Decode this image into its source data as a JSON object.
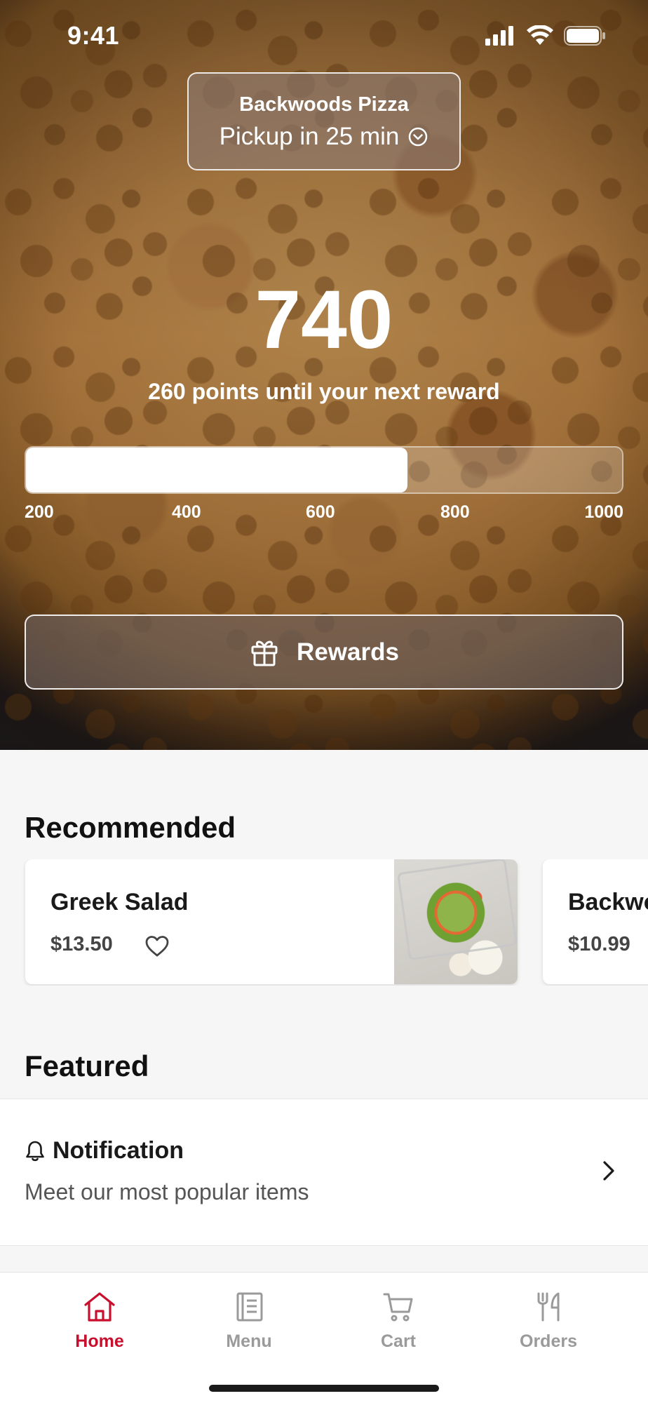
{
  "status_bar": {
    "time": "9:41"
  },
  "pickup": {
    "store_name": "Backwoods Pizza",
    "pickup_time": "Pickup in 25 min"
  },
  "points": {
    "value": "740",
    "subtitle": "260 points until your next reward",
    "progress_fraction": 0.64,
    "scale_labels": [
      "200",
      "400",
      "600",
      "800",
      "1000"
    ]
  },
  "rewards_button": {
    "label": "Rewards"
  },
  "recommended": {
    "title": "Recommended",
    "items": [
      {
        "name": "Greek Salad",
        "price": "$13.50"
      },
      {
        "name": "Backwo",
        "price": "$10.99"
      }
    ]
  },
  "featured": {
    "title": "Featured",
    "notification_title": "Notification",
    "notification_text": "Meet our most popular items"
  },
  "tabs": [
    {
      "label": "Home",
      "icon": "home-icon",
      "active": true
    },
    {
      "label": "Menu",
      "icon": "menu-icon",
      "active": false
    },
    {
      "label": "Cart",
      "icon": "cart-icon",
      "active": false
    },
    {
      "label": "Orders",
      "icon": "orders-icon",
      "active": false
    }
  ],
  "colors": {
    "accent": "#c8102e",
    "inactive": "#9a9a9a"
  }
}
